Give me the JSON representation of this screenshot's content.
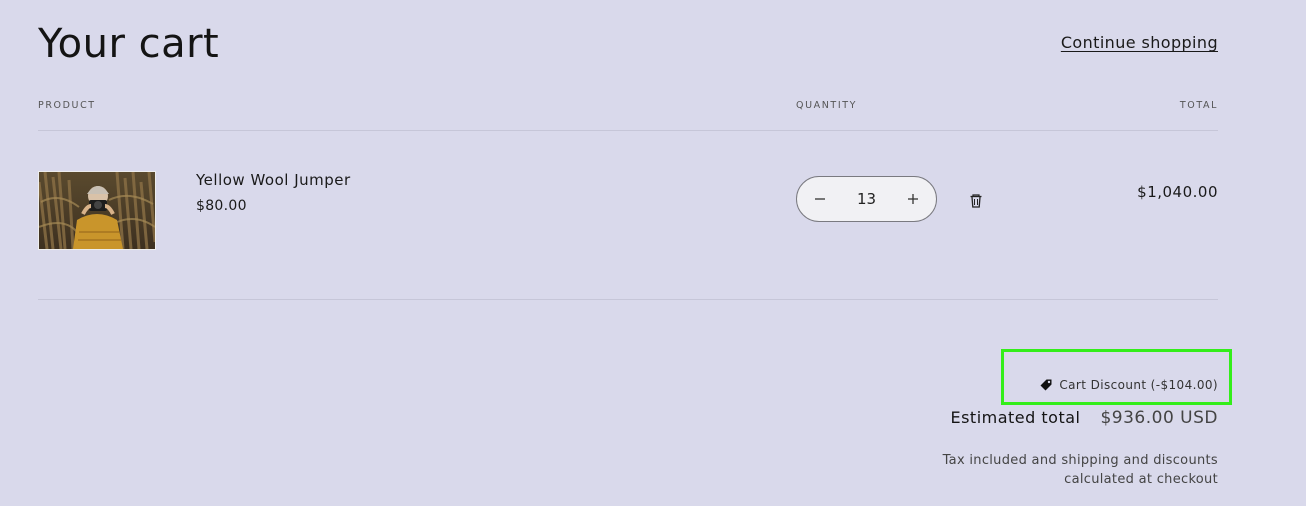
{
  "header": {
    "title": "Your cart",
    "continue_label": "Continue shopping"
  },
  "columns": {
    "product": "PRODUCT",
    "quantity": "QUANTITY",
    "total": "TOTAL"
  },
  "items": [
    {
      "name": "Yellow Wool Jumper",
      "price": "$80.00",
      "quantity": "13",
      "line_total": "$1,040.00",
      "image_icon": "product-photo"
    }
  ],
  "summary": {
    "discount_label": "Cart Discount (-$104.00)",
    "estimated_label": "Estimated total",
    "estimated_value": "$936.00 USD",
    "tax_note_line1": "Tax included and shipping and discounts",
    "tax_note_line2": "calculated at checkout"
  },
  "colors": {
    "background": "#d9d9eb",
    "highlight": "#33ee1a",
    "text": "#1a1a1a"
  }
}
